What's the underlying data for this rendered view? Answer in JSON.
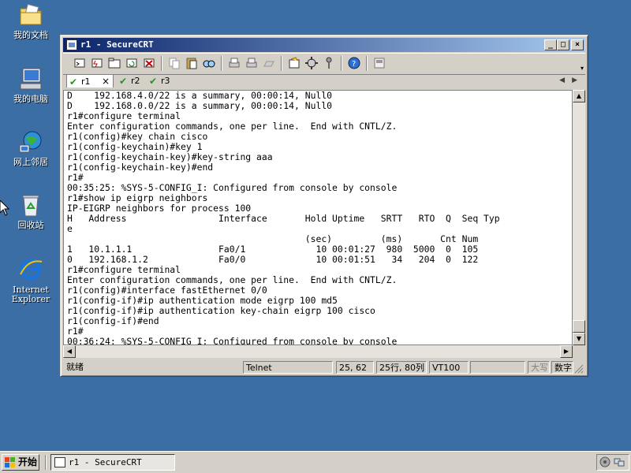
{
  "desktop": {
    "icons": [
      {
        "label": "我的文档",
        "icon": "my-documents-icon"
      },
      {
        "label": "我的电脑",
        "icon": "my-computer-icon"
      },
      {
        "label": "网上邻居",
        "icon": "network-places-icon"
      },
      {
        "label": "回收站",
        "icon": "recycle-bin-icon"
      },
      {
        "label": "Internet\nExplorer",
        "icon": "internet-explorer-icon"
      }
    ]
  },
  "window": {
    "title": "r1 - SecureCRT",
    "buttons": {
      "minimize": "_",
      "maximize": "□",
      "close": "×"
    }
  },
  "tabs": [
    {
      "label": "r1",
      "active": true,
      "close": "×"
    },
    {
      "label": "r2",
      "active": false
    },
    {
      "label": "r3",
      "active": false
    }
  ],
  "tab_nav": {
    "prev": "◀",
    "next": "▶"
  },
  "terminal": {
    "lines": [
      "D    192.168.4.0/22 is a summary, 00:00:14, Null0",
      "D    192.168.0.0/22 is a summary, 00:00:14, Null0",
      "r1#configure terminal",
      "Enter configuration commands, one per line.  End with CNTL/Z.",
      "r1(config)#key chain cisco",
      "r1(config-keychain)#key 1",
      "r1(config-keychain-key)#key-string aaa",
      "r1(config-keychain-key)#end",
      "r1#",
      "00:35:25: %SYS-5-CONFIG_I: Configured from console by console",
      "r1#show ip eigrp neighbors",
      "IP-EIGRP neighbors for process 100",
      "H   Address                 Interface       Hold Uptime   SRTT   RTO  Q  Seq Typ",
      "e",
      "                                            (sec)         (ms)       Cnt Num",
      "1   10.1.1.1                Fa0/1             10 00:01:27  980  5000  0  105",
      "0   192.168.1.2             Fa0/0             10 00:01:51   34   204  0  122",
      "r1#configure terminal",
      "Enter configuration commands, one per line.  End with CNTL/Z.",
      "r1(config)#interface fastEthernet 0/0",
      "r1(config-if)#ip authentication mode eigrp 100 md5",
      "r1(config-if)#ip authentication key-chain eigrp 100 cisco",
      "r1(config-if)#end",
      "r1#",
      "00:36:24: %SYS-5-CONFIG_I: Configured from console by console"
    ]
  },
  "statusbar": {
    "ready": "就绪",
    "protocol": "Telnet",
    "cursor_pos": "25, 62",
    "rows_cols": "25行, 80列",
    "terminal_type": "VT100",
    "empty": "",
    "caps": "大写",
    "num": "数字"
  },
  "taskbar": {
    "start": "开始",
    "task_title": "r1 - SecureCRT"
  }
}
